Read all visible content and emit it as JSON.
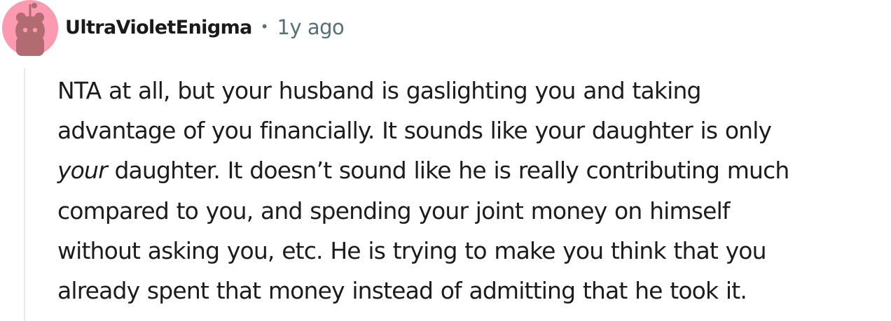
{
  "comment": {
    "author": "UltraVioletEnigma",
    "separator": "•",
    "age": "1y ago",
    "avatar_icon": "snoo-avatar-icon",
    "colors": {
      "avatar_bg": "#fb9ab1",
      "avatar_figure": "#b26b70",
      "username": "#1a1a1b",
      "meta": "#576f76",
      "body": "#1c1c1c",
      "thread_line": "#e5ebee"
    },
    "body": {
      "line1": "NTA at all, but your husband is gaslighting you and taking",
      "line2": "advantage of you financially. It sounds like your daughter is only",
      "line3_emph": "your",
      "line3_rest": " daughter. It doesn’t sound like he is really contributing much",
      "line4": "compared to you, and spending your joint money on himself",
      "line5": "without asking you, etc. He is trying to make you think that you",
      "line6": "already spent that money instead of admitting that he took it."
    }
  }
}
